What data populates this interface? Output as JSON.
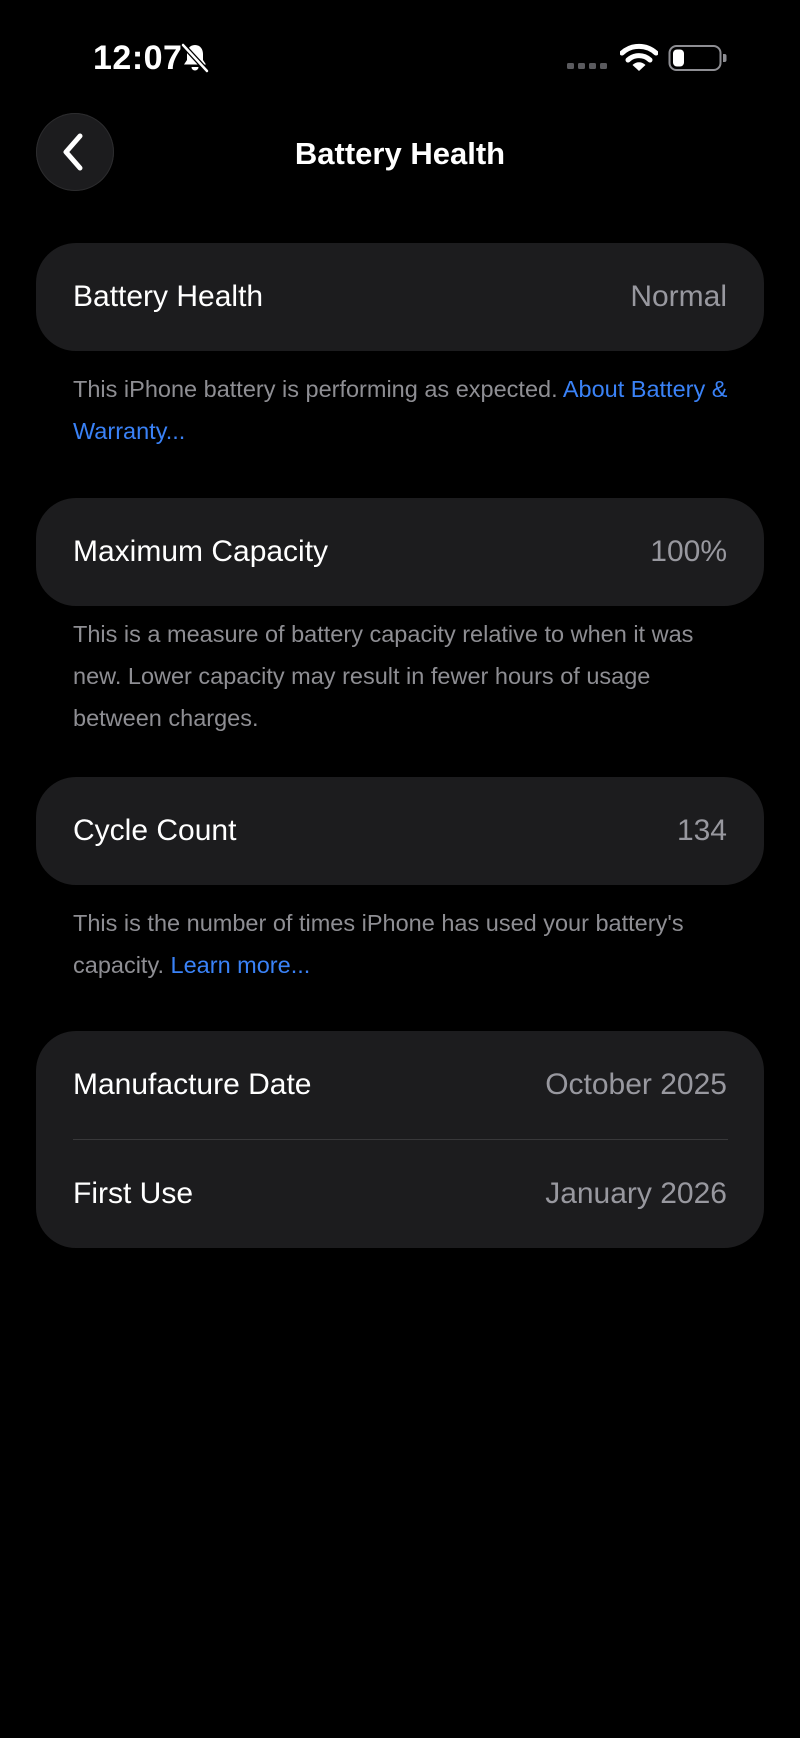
{
  "status_bar": {
    "time": "12:07",
    "icons": [
      "bell-slash-icon",
      "cellular-signal-icon",
      "wifi-icon",
      "battery-icon"
    ]
  },
  "nav": {
    "back_icon": "chevron-left-icon",
    "title": "Battery Health"
  },
  "battery_health": {
    "label": "Battery Health",
    "value": "Normal",
    "footnote": "This iPhone battery is performing as expected. ",
    "footnote_link": "About Battery & Warranty..."
  },
  "maximum_capacity": {
    "label": "Maximum Capacity",
    "value": "100%",
    "footnote": "This is a measure of battery capacity relative to when it was new. Lower capacity may result in fewer hours of usage between charges."
  },
  "cycle_count": {
    "label": "Cycle Count",
    "value": "134",
    "footnote": "This is the number of times iPhone has used your battery's capacity. ",
    "footnote_link": "Learn more..."
  },
  "dates": {
    "manufacture_label": "Manufacture Date",
    "manufacture_value": "October 2025",
    "first_use_label": "First Use",
    "first_use_value": "January 2026"
  },
  "colors": {
    "background": "#000000",
    "card": "#1c1c1e",
    "secondary_text": "#98989f",
    "link": "#3a82f7"
  }
}
